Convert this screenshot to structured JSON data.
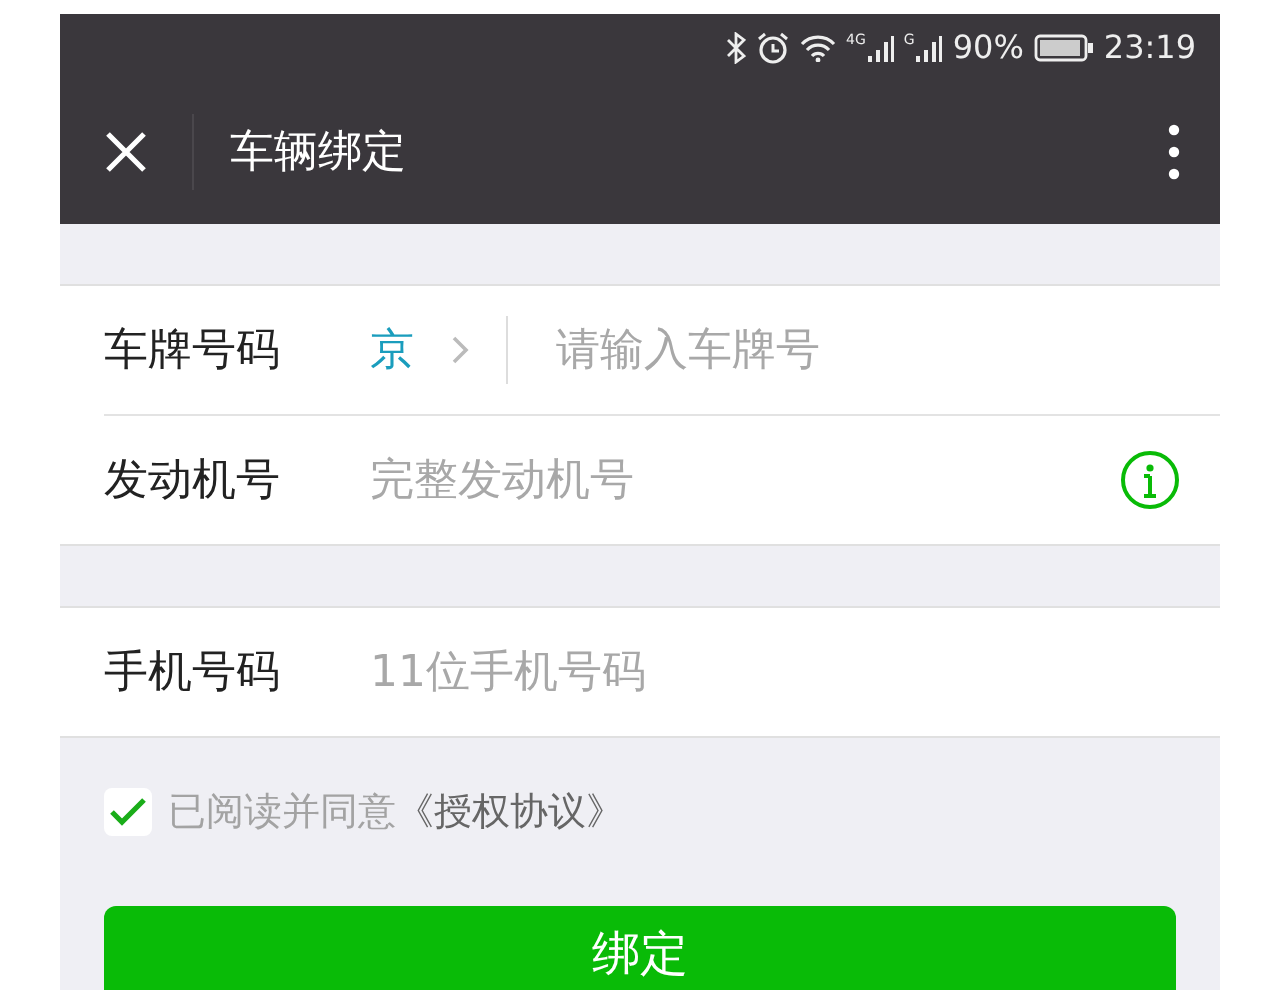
{
  "status_bar": {
    "network_1": "4G",
    "network_2": "G",
    "battery": "90%",
    "time": "23:19"
  },
  "nav": {
    "title": "车辆绑定"
  },
  "form_groups": [
    {
      "rows": [
        {
          "kind": "plate",
          "label": "车牌号码",
          "prefix": "京",
          "placeholder": "请输入车牌号"
        },
        {
          "kind": "info",
          "label": "发动机号",
          "placeholder": "完整发动机号"
        }
      ]
    },
    {
      "rows": [
        {
          "kind": "plain",
          "label": "手机号码",
          "placeholder": "11位手机号码"
        }
      ]
    }
  ],
  "agreement": {
    "checked": true,
    "text": "已阅读并同意",
    "link": "《授权协议》"
  },
  "submit_button": "绑定"
}
